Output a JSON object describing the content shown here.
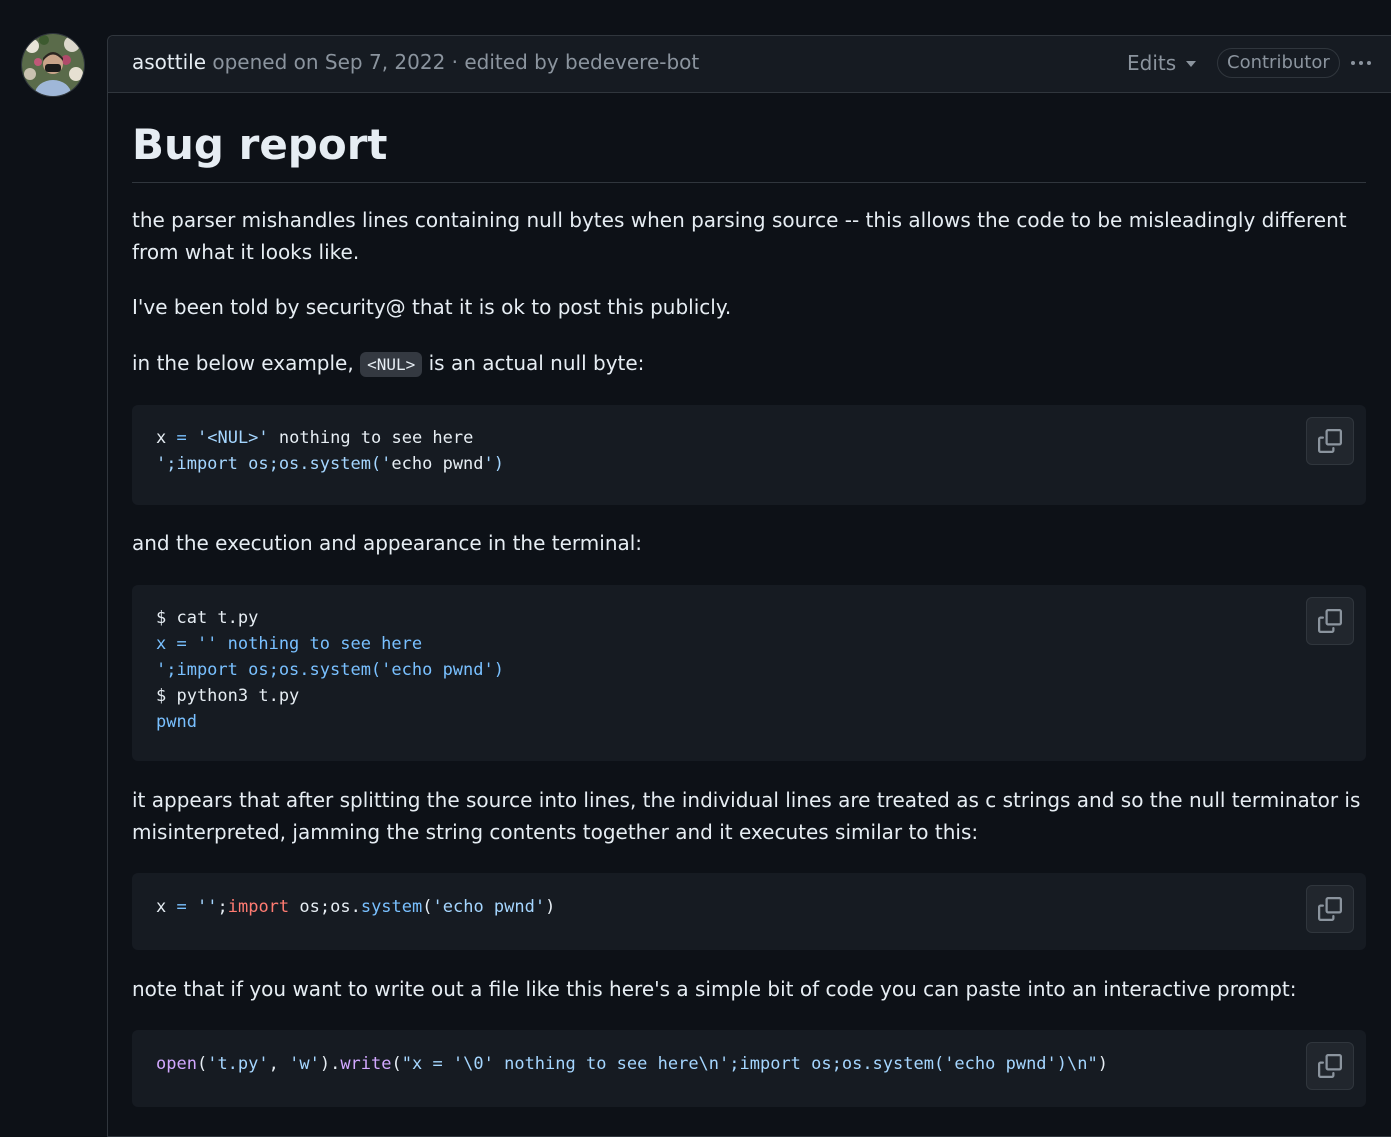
{
  "issue": {
    "author": "asottile",
    "meta_text": "opened on Sep 7, 2022 · edited by bedevere-bot",
    "edits_label": "Edits",
    "role_badge": "Contributor"
  },
  "content": {
    "title": "Bug report",
    "p1": "the parser mishandles lines containing null bytes when parsing source -- this allows the code to be misleadingly different from what it looks like.",
    "p2": "I've been told by security@ that it is ok to post this publicly.",
    "p3_before": "in the below example,",
    "p3_code": "<NUL>",
    "p3_after": "is an actual null byte:",
    "code1": {
      "l1_a": "x",
      "l1_b": "=",
      "l1_c": "'<NUL>'",
      "l1_d": "nothing to see here",
      "l2_a": "';import os;os.system('",
      "l2_b": "echo pwnd",
      "l2_c": "')"
    },
    "p4": "and the execution and appearance in the terminal:",
    "code2": [
      "$ cat t.py",
      "x = '' nothing to see here",
      "';import os;os.system('echo pwnd')",
      "$ python3 t.py",
      "pwnd"
    ],
    "p5": "it appears that after splitting the source into lines, the individual lines are treated as c strings and so the null terminator is misinterpreted, jamming the string contents together and it executes similar to this:",
    "code3": {
      "a": "x",
      "b": "=",
      "c": "''",
      "d": ";",
      "e": "import",
      "f": "os;os.",
      "g": "system",
      "h": "(",
      "i": "'echo pwnd'",
      "j": ")"
    },
    "p6": "note that if you want to write out a file like this here's a simple bit of code you can paste into an interactive prompt:",
    "code4": {
      "a": "open",
      "b": "(",
      "c": "'t.py'",
      "d": ", ",
      "e": "'w'",
      "f": ").",
      "g": "write",
      "h": "(",
      "i": "\"x = '\\0' nothing to see here\\n';import os;os.system('echo pwnd')\\n\"",
      "j": ")"
    }
  },
  "colors": {
    "background": "#0d1117",
    "header_bg": "#161b22",
    "border": "#30363d",
    "text": "#e6edf3",
    "muted": "#8b949e",
    "string": "#a5d6ff",
    "keyword": "#ff7b72",
    "function": "#d2a8ff"
  },
  "icons": [
    "avatar",
    "caret-down-icon",
    "kebab-icon",
    "copy-icon"
  ]
}
